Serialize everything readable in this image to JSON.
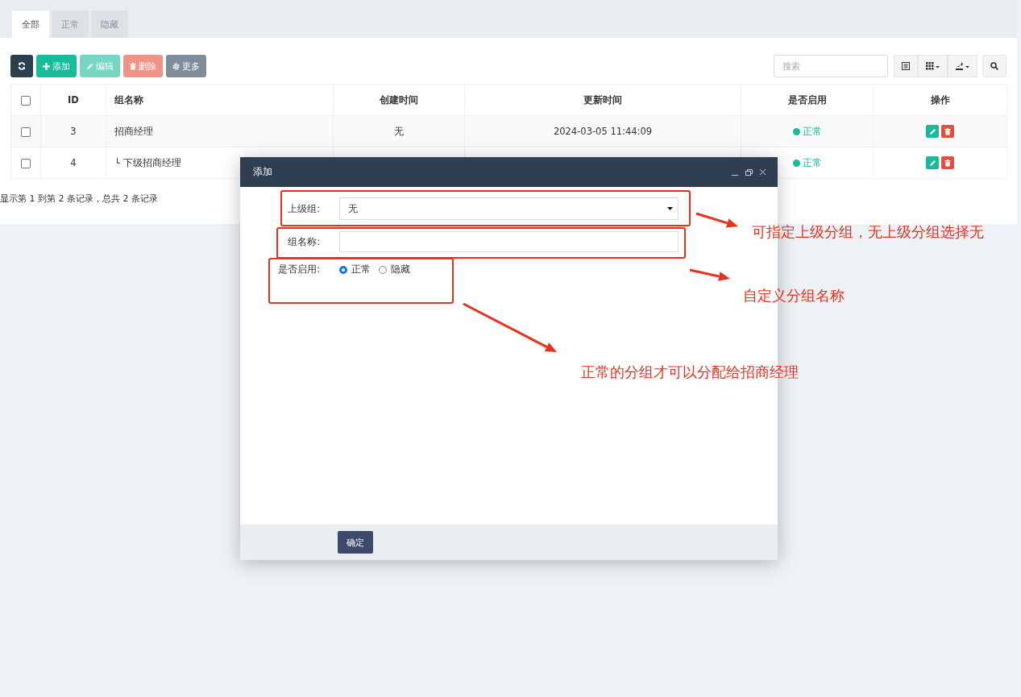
{
  "tabs": [
    {
      "label": "全部",
      "selected": true
    },
    {
      "label": "正常",
      "selected": false
    },
    {
      "label": "隐藏",
      "selected": false
    }
  ],
  "toolbar": [
    {
      "kind": "refresh",
      "disabled": false
    },
    {
      "kind": "add",
      "label": "添加",
      "disabled": false
    },
    {
      "kind": "edit",
      "label": "编辑",
      "disabled": true
    },
    {
      "kind": "delete",
      "label": "删除",
      "disabled": true
    },
    {
      "kind": "more",
      "label": "更多",
      "disabled": false
    }
  ],
  "search": {
    "placeholder": "搜索"
  },
  "right_tools": [
    {
      "kind": "toggle-view"
    },
    {
      "kind": "columns"
    },
    {
      "kind": "export"
    },
    {
      "kind": "search"
    }
  ],
  "table": {
    "columns": [
      "ID",
      "组名称",
      "创建时间",
      "更新时间",
      "是否启用",
      "操作"
    ],
    "header_checked": false,
    "rows": [
      {
        "checked": false,
        "id": "3",
        "name": "招商经理",
        "created": "无",
        "updated": "2024-03-05 11:44:09",
        "status": {
          "label": "正常",
          "color": "#18bc9c"
        },
        "children": [
          {
            "checked": false,
            "id": "4",
            "name": "└ 下级招商经理",
            "status": {
              "label": "正常",
              "color": "#18bc9c"
            }
          }
        ]
      }
    ]
  },
  "pagination_info": "显示第 1 到第 2 条记录，总共 2 条记录",
  "modal": {
    "title": "添加",
    "fields": [
      {
        "kind": "select",
        "label": "上级组:",
        "value": "无"
      },
      {
        "kind": "text",
        "label": "组名称:"
      },
      {
        "kind": "radio",
        "label": "是否启用:",
        "options": [
          {
            "label": "正常",
            "selected": true
          },
          {
            "label": "隐藏",
            "selected": false
          }
        ]
      }
    ],
    "confirm": "确定"
  },
  "annotations": [
    "可指定上级分组，无上级分组选择无",
    "自定义分组名称",
    "正常的分组才可以分配给招商经理"
  ]
}
